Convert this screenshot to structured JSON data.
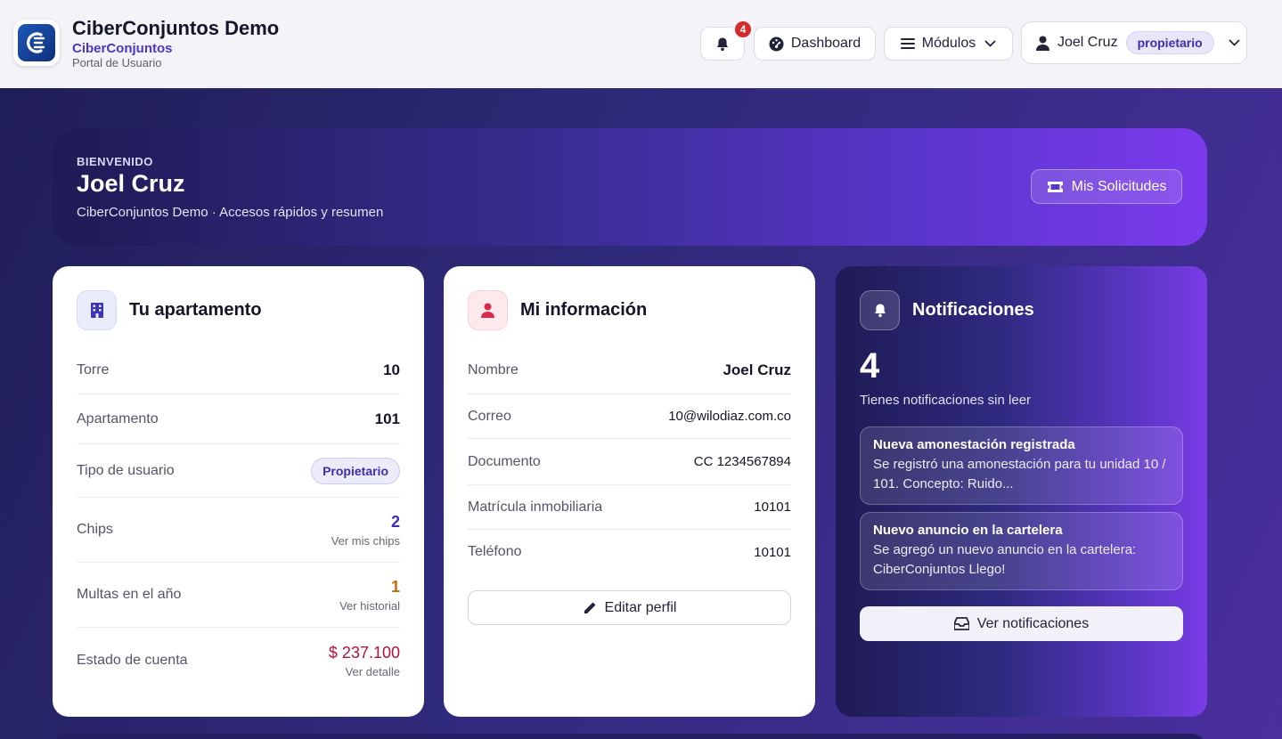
{
  "header": {
    "title": "CiberConjuntos Demo",
    "brand": "CiberConjuntos",
    "portal": "Portal de Usuario",
    "notification_count": "4",
    "dashboard_label": "Dashboard",
    "modules_label": "Módulos",
    "user_name": "Joel Cruz",
    "user_role": "propietario"
  },
  "hero": {
    "kicker": "BIENVENIDO",
    "name": "Joel Cruz",
    "description": "CiberConjuntos Demo · Accesos rápidos y resumen",
    "button_label": "Mis Solicitudes"
  },
  "apartment": {
    "title": "Tu apartamento",
    "rows": [
      {
        "label": "Torre",
        "value": "10"
      },
      {
        "label": "Apartamento",
        "value": "101"
      },
      {
        "label": "Tipo de usuario",
        "value": "Propietario"
      },
      {
        "label": "Chips",
        "value": "2",
        "link": "Ver mis chips"
      },
      {
        "label": "Multas en el año",
        "value": "1",
        "link": "Ver historial"
      },
      {
        "label": "Estado de cuenta",
        "value": "$ 237.100",
        "link": "Ver detalle"
      }
    ]
  },
  "info": {
    "title": "Mi información",
    "rows": [
      {
        "label": "Nombre",
        "value": "Joel Cruz"
      },
      {
        "label": "Correo",
        "value": "10@wilodiaz.com.co"
      },
      {
        "label": "Documento",
        "value": "CC 1234567894"
      },
      {
        "label": "Matrícula inmobiliaria",
        "value": "10101"
      },
      {
        "label": "Teléfono",
        "value": "10101"
      }
    ],
    "edit_label": "Editar perfil"
  },
  "notifications": {
    "title": "Notificaciones",
    "count": "4",
    "subtitle": "Tienes notificaciones sin leer",
    "items": [
      {
        "title": "Nueva amonestación registrada",
        "text": "Se registró una amonestación para tu unidad 10 / 101. Concepto: Ruido..."
      },
      {
        "title": "Nuevo anuncio en la cartelera",
        "text": "Se agregó un nuevo anuncio en la cartelera: CiberConjuntos Llego!"
      }
    ],
    "button_label": "Ver notificaciones"
  },
  "colors": {
    "accent": "#4b36c8",
    "chips": "#3d2fb0",
    "fines": "#c26a0a",
    "balance": "#b3123a",
    "user_icon_bg": "#fde8ec",
    "apartment_icon_bg": "#e8ecfb"
  }
}
